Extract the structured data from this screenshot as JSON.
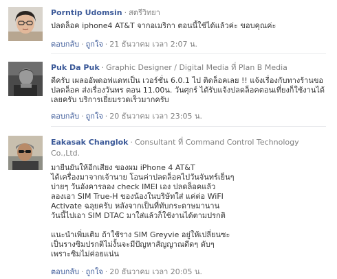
{
  "comments": [
    {
      "name": "Porntip Udomsin",
      "meta": "สตรีวิทยา",
      "text": "ปลดล็อค iphone4 AT&T จากอเมริกา ตอนนี้ใช้ได้แล้วค่ะ ขอบคุณค่ะ",
      "reply_label": "ตอบกลับ",
      "like_label": "ถูกใจ",
      "timestamp": "21 ธันวาคม เวลา 2:07 น."
    },
    {
      "name": "Puk Da Puk",
      "meta": "Graphic Designer / Digital Media ที่ Plan B Media",
      "text": "ดีครับ เผลออัพดอฟแดทเป็น เวอร์ชั่น 6.0.1 ไป ติดล็อคเลย !! แจ้งเรื่องกับทางร้านขอปลดล็อค ส่งเรื่องวันพร ตอน 11.00น. วันศุกร์ ได้รับแจ้งปลดล็อคตอนเที่ยงก็ใช้งานได้เลยครับ บริการเยี่ยมรวดเร็วมากครับ",
      "reply_label": "ตอบกลับ",
      "like_label": "ถูกใจ",
      "timestamp": "20 ธันวาคม เวลา 23:05 น."
    },
    {
      "name": "Eakasak Changlok",
      "meta": "Consultant ที่ Command Control Technology Co.,Ltd.",
      "text": "มายืนยันให้อีกเสียง ของผม iPhone 4 AT&T\nได้เครื่องมาจากเจ้านาย โอนค่าปลดล็อคไปวันจันทร์เย็นๆ\nบ่ายๆ วันอังคารลอง check IMEI เอง ปลดล็อคแล้ว\nลองเอา SIM True-H ของน้องในบริษัทใส่ แค่ต่อ WiFI\nActivate ฉลุยครับ หลังจากเป็นที่ทับกระดาษมานาน\nวันนี้ไปเอา SIM DTAC มาใส่แล้วก็ใช้งานได้ตามปรกติ\n\nแนะนำเพิ่มเติม ถ้าใช้ราง SIM Greyvie อยู่ให้เปลี่ยนซะ\nเป็นรางซิมปรกติไม่งั้นจะมีปัญหาสัญญาณดีดๆ ดับๆ\nเพราะซิมไม่ค่อยแน่น",
      "reply_label": "ตอบกลับ",
      "like_label": "ถูกใจ",
      "timestamp": "20 ธันวาคม เวลา 20:05 น."
    }
  ]
}
